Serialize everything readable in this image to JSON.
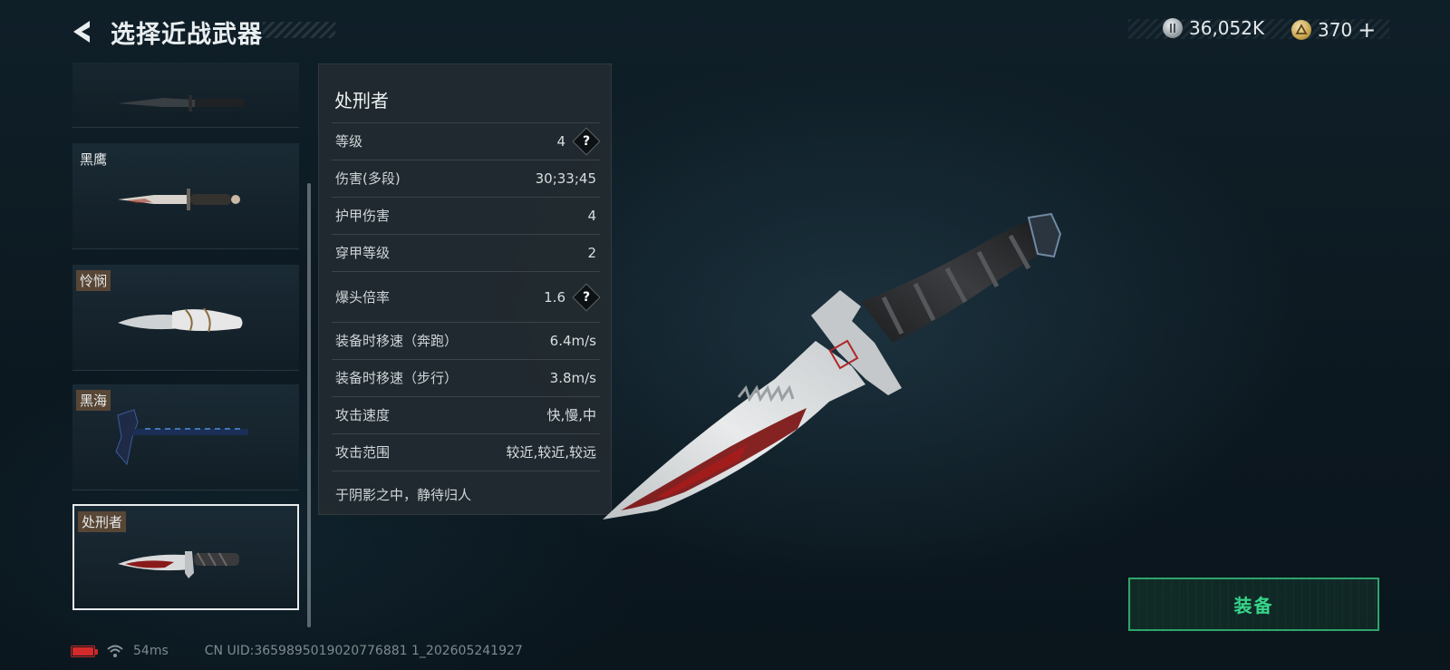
{
  "header": {
    "title": "选择近战武器",
    "back_icon": "chevron-left-icon"
  },
  "currency": {
    "coins": {
      "icon": "silver-coin-icon",
      "value": "36,052K"
    },
    "premium": {
      "icon": "gold-triangle-coin-icon",
      "value": "370",
      "add_symbol": "+"
    }
  },
  "weapons": [
    {
      "name": "",
      "tagged": false,
      "type": "combat-knife"
    },
    {
      "name": "黑鹰",
      "tagged": false,
      "type": "dagger"
    },
    {
      "name": "怜悯",
      "tagged": true,
      "type": "ornate-knife"
    },
    {
      "name": "黑海",
      "tagged": true,
      "type": "tomahawk"
    },
    {
      "name": "处刑者",
      "tagged": true,
      "type": "executioner-knife",
      "selected": true
    }
  ],
  "detail": {
    "name": "处刑者",
    "stats": [
      {
        "label": "等级",
        "value": "4",
        "help": true
      },
      {
        "label": "伤害(多段)",
        "value": "30;33;45",
        "help": false
      },
      {
        "label": "护甲伤害",
        "value": "4",
        "help": false
      },
      {
        "label": "穿甲等级",
        "value": "2",
        "help": false
      },
      {
        "label": "爆头倍率",
        "value": "1.6",
        "help": true
      },
      {
        "label": "装备时移速（奔跑）",
        "value": "6.4m/s",
        "help": false
      },
      {
        "label": "装备时移速（步行）",
        "value": "3.8m/s",
        "help": false
      },
      {
        "label": "攻击速度",
        "value": "快,慢,中",
        "help": false
      },
      {
        "label": "攻击范围",
        "value": "较近,较近,较远",
        "help": false
      }
    ],
    "quote": "于阴影之中，静待归人",
    "help_symbol": "?"
  },
  "equip_button": {
    "label": "装备"
  },
  "status": {
    "battery": "battery-low-icon",
    "wifi": "wifi-icon",
    "ping": "54ms",
    "uid": "CN UID:3659895019020776881 1_202605241927"
  },
  "colors": {
    "accent_green": "#37d68a",
    "battery_red": "#d42a2a",
    "panel_bg": "#222a30"
  }
}
